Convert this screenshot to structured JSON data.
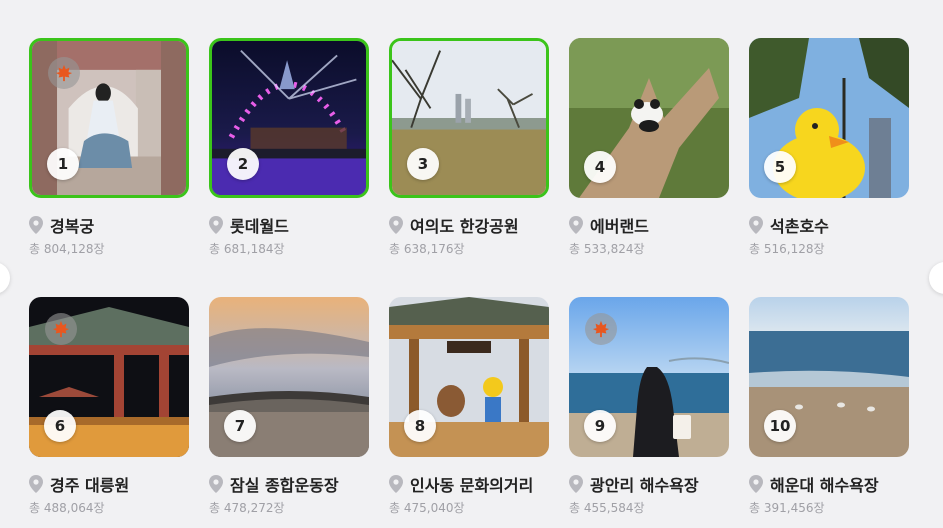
{
  "places": [
    {
      "rank": "1",
      "name": "경복궁",
      "count": "총 804,128장",
      "maple": true,
      "highlight": true
    },
    {
      "rank": "2",
      "name": "롯데월드",
      "count": "총 681,184장",
      "maple": false,
      "highlight": true
    },
    {
      "rank": "3",
      "name": "여의도 한강공원",
      "count": "총 638,176장",
      "maple": false,
      "highlight": true
    },
    {
      "rank": "4",
      "name": "에버랜드",
      "count": "총 533,824장",
      "maple": false,
      "highlight": false
    },
    {
      "rank": "5",
      "name": "석촌호수",
      "count": "총 516,128장",
      "maple": false,
      "highlight": false
    },
    {
      "rank": "6",
      "name": "경주 대릉원",
      "count": "총 488,064장",
      "maple": true,
      "highlight": false
    },
    {
      "rank": "7",
      "name": "잠실 종합운동장",
      "count": "총 478,272장",
      "maple": false,
      "highlight": false
    },
    {
      "rank": "8",
      "name": "인사동 문화의거리",
      "count": "총 475,040장",
      "maple": false,
      "highlight": false
    },
    {
      "rank": "9",
      "name": "광안리 해수욕장",
      "count": "총 455,584장",
      "maple": true,
      "highlight": false
    },
    {
      "rank": "10",
      "name": "해운대 해수욕장",
      "count": "총 391,456장",
      "maple": false,
      "highlight": false
    }
  ],
  "colors": {
    "highlight_border": "#3bc41a",
    "maple_leaf": "#e8571f",
    "pin": "#b8b8be"
  },
  "icons": {
    "location": "location-pin-icon",
    "maple": "maple-leaf-icon",
    "prev": "chevron-left-icon",
    "next": "chevron-right-icon"
  }
}
